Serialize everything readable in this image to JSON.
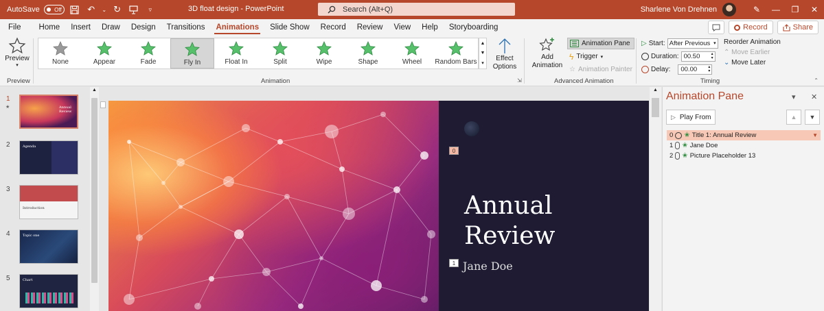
{
  "titlebar": {
    "autosave_label": "AutoSave",
    "autosave_state": "Off",
    "doc_title": "3D float design  -  PowerPoint",
    "search_placeholder": "Search (Alt+Q)",
    "user_name": "Sharlene Von Drehnen",
    "accent_color": "#b7472a"
  },
  "tabs": [
    "File",
    "Home",
    "Insert",
    "Draw",
    "Design",
    "Transitions",
    "Animations",
    "Slide Show",
    "Record",
    "Review",
    "View",
    "Help",
    "Storyboarding"
  ],
  "active_tab": "Animations",
  "tab_actions": {
    "record_label": "Record",
    "share_label": "Share"
  },
  "ribbon": {
    "preview": {
      "label": "Preview",
      "group": "Preview"
    },
    "gallery": {
      "group": "Animation",
      "items": [
        "None",
        "Appear",
        "Fade",
        "Fly In",
        "Float In",
        "Split",
        "Wipe",
        "Shape",
        "Wheel",
        "Random Bars"
      ],
      "selected": "Fly In"
    },
    "effect_options": {
      "line1": "Effect",
      "line2": "Options"
    },
    "advanced": {
      "group": "Advanced Animation",
      "add_line1": "Add",
      "add_line2": "Animation",
      "animation_pane": "Animation Pane",
      "trigger": "Trigger",
      "animation_painter": "Animation Painter"
    },
    "timing": {
      "group": "Timing",
      "start_label": "Start:",
      "start_value": "After Previous",
      "duration_label": "Duration:",
      "duration_value": "00.50",
      "delay_label": "Delay:",
      "delay_value": "00.00",
      "reorder_label": "Reorder Animation",
      "move_earlier": "Move Earlier",
      "move_later": "Move Later"
    }
  },
  "thumbnails": [
    {
      "number": "1",
      "title": "Annual Review",
      "active": true
    },
    {
      "number": "2",
      "title": "Agenda",
      "active": false
    },
    {
      "number": "3",
      "title": "Introduction",
      "active": false
    },
    {
      "number": "4",
      "title": "Topic one",
      "active": false
    },
    {
      "number": "5",
      "title": "Chart",
      "active": false
    }
  ],
  "slide": {
    "title_line1": "Annual",
    "title_line2": "Review",
    "subtitle": "Jane Doe",
    "tag_title": "0",
    "tag_subtitle": "1"
  },
  "animation_pane": {
    "title": "Animation Pane",
    "play_from": "Play From",
    "items": [
      {
        "index": "0",
        "name": "Title 1: Annual Review",
        "trigger": "clock",
        "selected": true
      },
      {
        "index": "1",
        "name": "Jane Doe",
        "trigger": "mouse",
        "selected": false
      },
      {
        "index": "2",
        "name": "Picture Placeholder 13",
        "trigger": "mouse",
        "selected": false
      }
    ]
  }
}
